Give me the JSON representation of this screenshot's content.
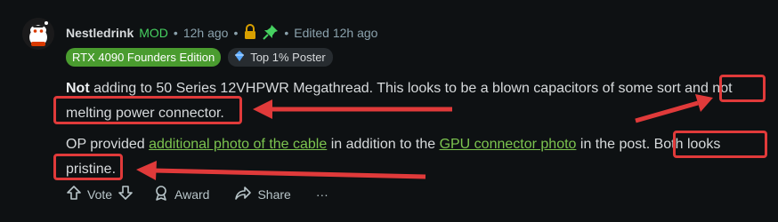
{
  "comment": {
    "author": "Nestledrink",
    "mod_label": "MOD",
    "sep": "•",
    "time": "12h ago",
    "edited": "Edited 12h ago",
    "flairs": {
      "green": "RTX 4090 Founders Edition",
      "top": "Top 1% Poster"
    },
    "p1": {
      "bold": "Not",
      "text": " adding to 50 Series 12VHPWR Megathread. This looks to be a blown capacitors of some sort and not melting power connector."
    },
    "p2": {
      "before": "OP provided ",
      "link1": "additional photo of the cable",
      "middle": " in addition to the ",
      "link2": "GPU connector photo",
      "after": " in the post. Both looks pristine."
    },
    "actions": {
      "vote": "Vote",
      "award": "Award",
      "share": "Share",
      "more": "···"
    }
  },
  "colors": {
    "background": "#0e1113",
    "mod": "#46d160",
    "flair_green": "#4a9c2f",
    "link": "#7cc44f",
    "annotation": "#e03a3a"
  },
  "icons": [
    "avatar",
    "lock-icon",
    "pin-icon",
    "pencil-icon",
    "trophy-icon",
    "upvote-icon",
    "downvote-icon",
    "award-icon",
    "share-icon",
    "more-icon"
  ]
}
